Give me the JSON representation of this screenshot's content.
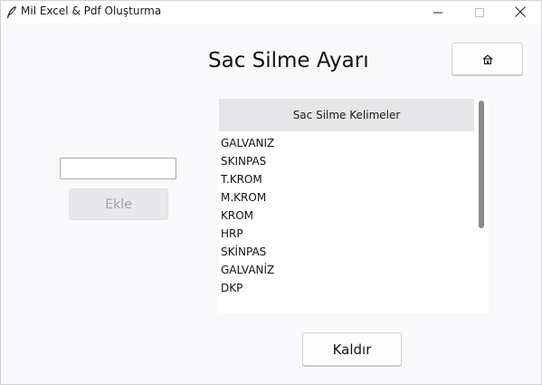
{
  "window": {
    "title": "Mil Excel & Pdf Oluşturma",
    "icon": "feather-icon",
    "controls": {
      "minimize": "minimize-icon",
      "maximize": "maximize-icon",
      "close": "close-icon"
    }
  },
  "main": {
    "heading": "Sac Silme Ayarı",
    "home_button_icon": "home-icon",
    "input": {
      "value": "",
      "placeholder": ""
    },
    "add_button_label": "Ekle",
    "list_header": "Sac Silme Kelimeler",
    "list_items": [
      "GALVANIZ",
      "SKINPAS",
      "T.KROM",
      "M.KROM",
      "KROM",
      "HRP",
      "SKİNPAS",
      "GALVANİZ",
      "DKP"
    ],
    "remove_button_label": "Kaldır"
  },
  "colors": {
    "window_bg": "#f9f9fb",
    "header_bg": "#e6e6e8",
    "disabled_text": "#a2a2a8",
    "scroll_thumb": "#8a8a8a"
  }
}
